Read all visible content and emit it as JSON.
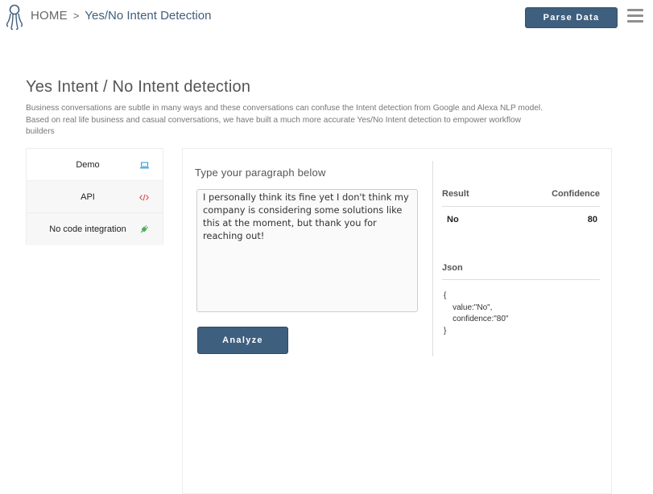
{
  "header": {
    "breadcrumb_home": "HOME",
    "breadcrumb_separator": ">",
    "breadcrumb_current": "Yes/No Intent Detection",
    "parse_button_label": "Parse Data",
    "logo_icon": "octopus-logo-icon",
    "menu_icon": "hamburger-menu-icon"
  },
  "page": {
    "title": "Yes Intent / No Intent detection",
    "description": "Business conversations are subtle in many ways and these conversations can confuse the Intent detection from Google and Alexa NLP model. Based on real life business and casual conversations, we have built a much more accurate Yes/No Intent detection to empower workflow builders"
  },
  "sidebar": {
    "items": [
      {
        "label": "Demo",
        "icon": "laptop-icon",
        "active": true
      },
      {
        "label": "API",
        "icon": "code-icon",
        "active": false
      },
      {
        "label": "No code integration",
        "icon": "plug-icon",
        "active": false
      }
    ]
  },
  "main": {
    "input_label": "Type your paragraph below",
    "paragraph_value": "I personally think its fine yet I don't think my company is considering some solutions like this at the moment, but thank you for reaching out!",
    "analyze_label": "Analyze"
  },
  "result": {
    "header_result": "Result",
    "header_confidence": "Confidence",
    "value_result": "No",
    "value_confidence": "80",
    "json_label": "Json",
    "json_text": "{\n    value:\"No\",\n    confidence:\"80\"\n}"
  },
  "colors": {
    "primary": "#3f5f7e",
    "breadcrumb_current": "#3d5e7c",
    "demo_icon": "#3aa0d6",
    "api_icon": "#d9534f",
    "integration_icon": "#4caf50"
  }
}
